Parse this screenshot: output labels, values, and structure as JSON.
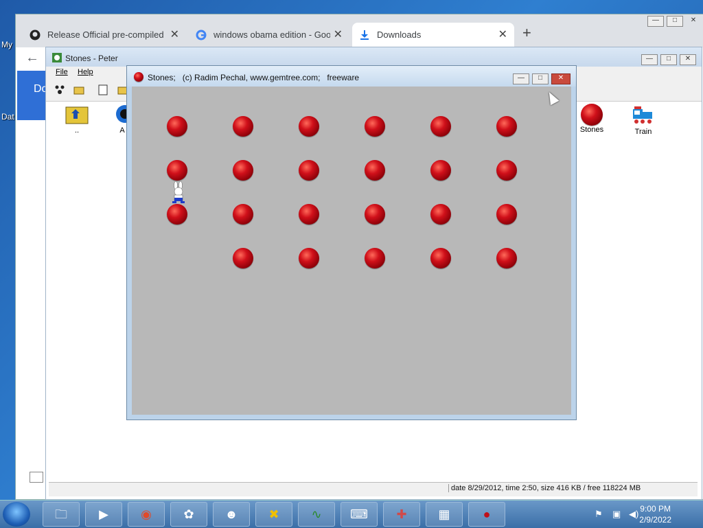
{
  "desktop": {
    "labels": [
      "My",
      "Dat"
    ]
  },
  "browser": {
    "tabs": [
      {
        "title": "Release Official pre-compiled ins",
        "icon": "github-icon",
        "active": false
      },
      {
        "title": "windows obama edition - Googl",
        "icon": "google-icon",
        "active": false
      },
      {
        "title": "Downloads",
        "icon": "download-icon",
        "active": true
      }
    ],
    "new_tab": "+",
    "close_glyph": "✕",
    "back_glyph": "←",
    "side_text": "Do"
  },
  "peter": {
    "title": "Stones - Peter",
    "menu": [
      {
        "label": "File"
      },
      {
        "label": "Help"
      }
    ],
    "files": [
      {
        "label": "..",
        "icon": "folder-up-icon"
      },
      {
        "label": "A",
        "icon": "app-icon"
      },
      {
        "label": "Stones",
        "icon": "stone-icon"
      },
      {
        "label": "Train",
        "icon": "train-icon"
      }
    ],
    "status": "date 8/29/2012, time 2:50, size 416 KB / free 118224 MB"
  },
  "stones_game": {
    "title": "Stones;   (c) Radim Pechal, www.gemtree.com;   freeware",
    "grid": {
      "rows": [
        [
          1,
          1,
          1,
          1,
          1,
          1
        ],
        [
          1,
          1,
          1,
          1,
          1,
          1
        ],
        [
          1,
          1,
          1,
          1,
          1,
          1
        ],
        [
          0,
          1,
          1,
          1,
          1,
          1
        ]
      ]
    },
    "player_icon": "rabbit-icon"
  },
  "window_buttons": {
    "minimize": "—",
    "maximize": "□",
    "close": "✕"
  },
  "taskbar": {
    "apps": [
      "explorer-icon",
      "media-player-icon",
      "chrome-icon",
      "rabbit-icon",
      "alien-icon",
      "x-icon",
      "wave-icon",
      "cmd-icon",
      "cross-icon",
      "puzzle-icon",
      "stone-icon"
    ],
    "time": "9:00 PM",
    "date": "2/9/2022"
  },
  "colors": {
    "stone": "#c0101a",
    "field": "#b8b8b8",
    "window_frame": "#bcd3ea"
  }
}
